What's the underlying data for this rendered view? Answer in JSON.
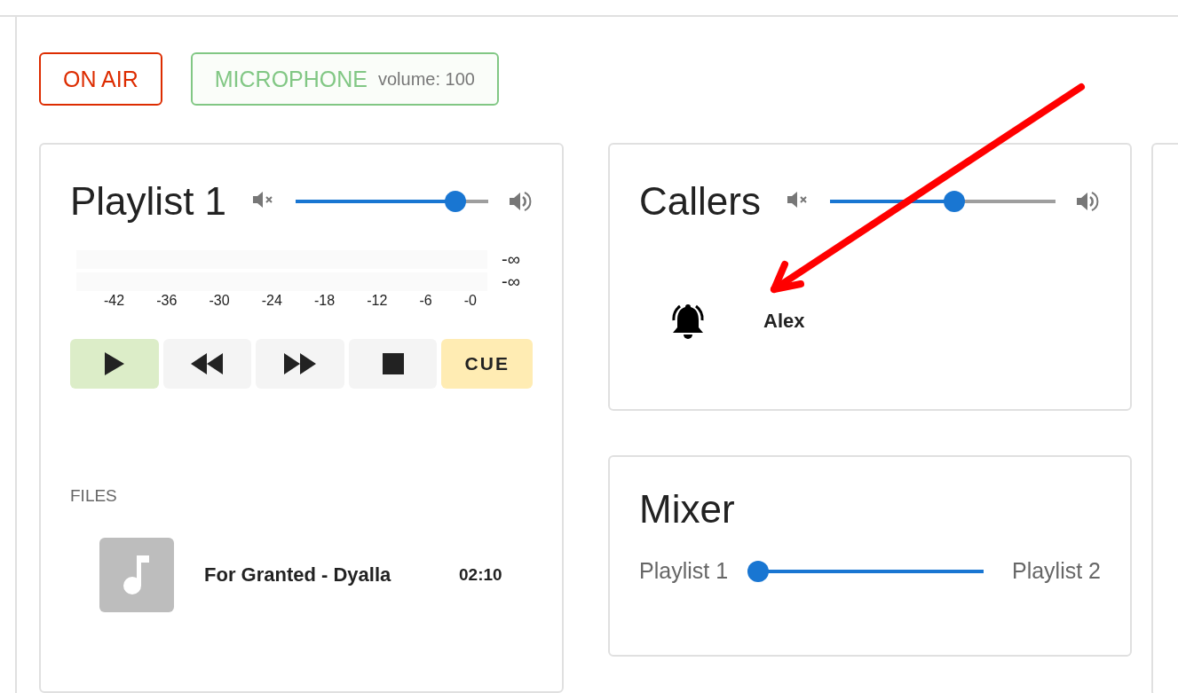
{
  "status": [
    {
      "kind": "onair",
      "label": "ON AIR"
    },
    {
      "kind": "mic",
      "label": "MICROPHONE",
      "detail": "volume: 100"
    }
  ],
  "playlist": {
    "title": "Playlist 1",
    "volume": {
      "level": 0.83
    },
    "meter": {
      "readings": [
        "-∞",
        "-∞"
      ],
      "scale": [
        "-42",
        "-36",
        "-30",
        "-24",
        "-18",
        "-12",
        "-6",
        "-0"
      ]
    },
    "transport": [
      {
        "kind": "play"
      },
      {
        "kind": "rewind"
      },
      {
        "kind": "forward"
      },
      {
        "kind": "stop"
      },
      {
        "kind": "cue",
        "label": "CUE"
      }
    ],
    "files_heading": "FILES",
    "files": [
      {
        "title": "For Granted - Dyalla",
        "duration": "02:10"
      }
    ]
  },
  "callers": {
    "title": "Callers",
    "volume": {
      "level": 0.55
    },
    "items": [
      {
        "name": "Alex",
        "ringing": true
      }
    ]
  },
  "mixer": {
    "title": "Mixer",
    "left": "Playlist 1",
    "right": "Playlist 2",
    "level": 0
  }
}
